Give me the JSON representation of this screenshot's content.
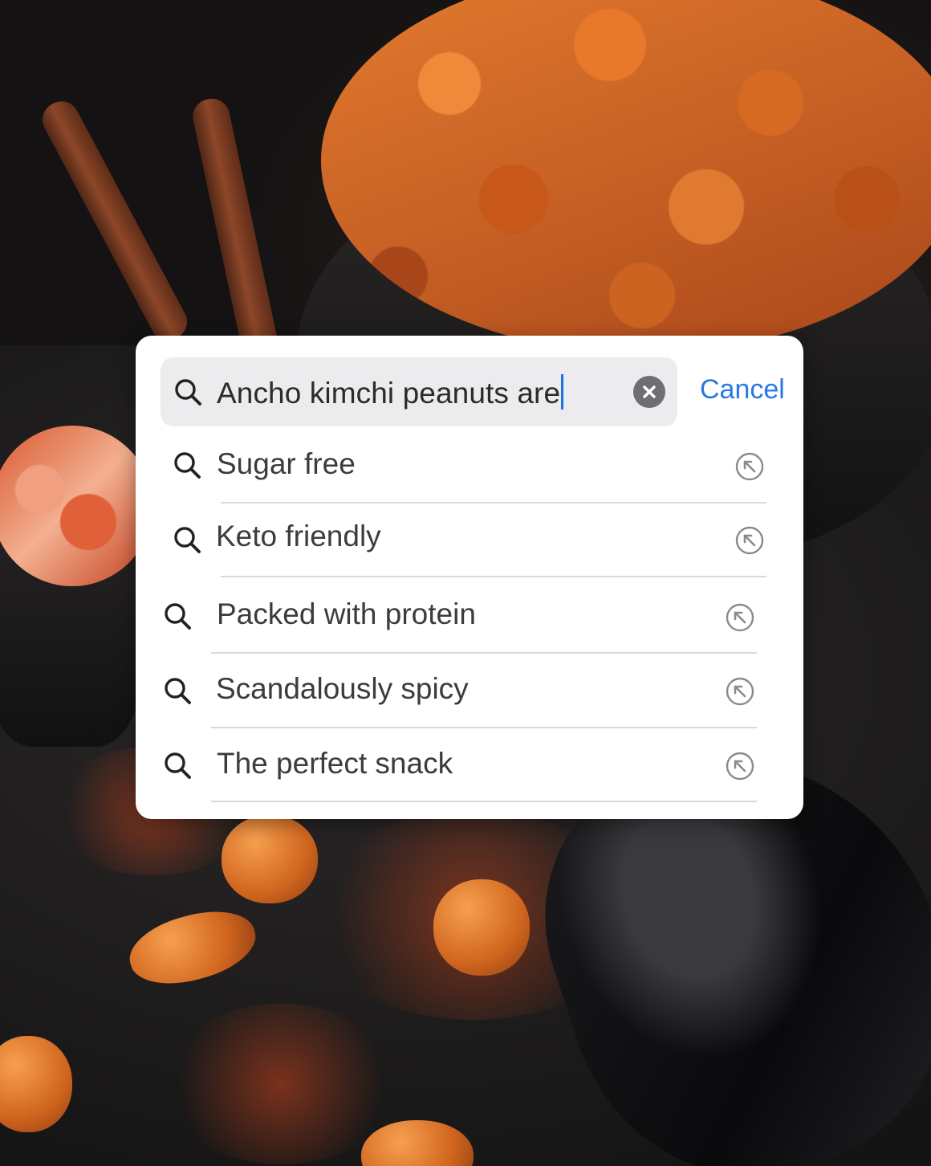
{
  "search": {
    "query": "Ancho kimchi peanuts are",
    "cancel_label": "Cancel"
  },
  "suggestions": [
    {
      "label": "Sugar free"
    },
    {
      "label": "Keto friendly"
    },
    {
      "label": "Packed with protein"
    },
    {
      "label": "Scandalously spicy"
    },
    {
      "label": "The perfect snack"
    }
  ],
  "icons": {
    "search": "magnifier-icon",
    "clear": "clear-x-icon",
    "fill": "arrow-up-left-circle-icon"
  },
  "colors": {
    "accent": "#2a78e4",
    "caret": "#1a73e8",
    "field_bg": "#ececee",
    "text": "#3c3c3c"
  }
}
